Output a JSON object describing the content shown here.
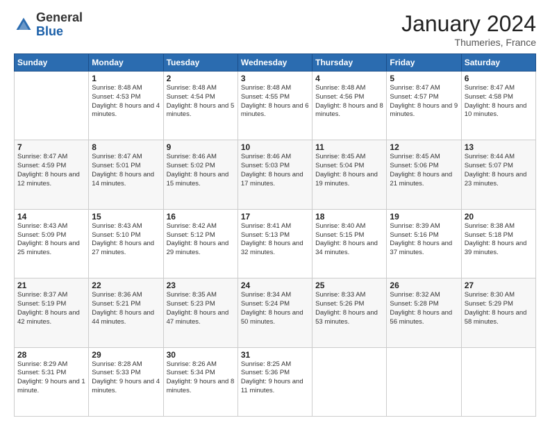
{
  "logo": {
    "general": "General",
    "blue": "Blue"
  },
  "header": {
    "title": "January 2024",
    "location": "Thumeries, France"
  },
  "weekdays": [
    "Sunday",
    "Monday",
    "Tuesday",
    "Wednesday",
    "Thursday",
    "Friday",
    "Saturday"
  ],
  "weeks": [
    [
      {
        "day": "",
        "sunrise": "",
        "sunset": "",
        "daylight": ""
      },
      {
        "day": "1",
        "sunrise": "8:48 AM",
        "sunset": "4:53 PM",
        "daylight": "8 hours and 4 minutes."
      },
      {
        "day": "2",
        "sunrise": "8:48 AM",
        "sunset": "4:54 PM",
        "daylight": "8 hours and 5 minutes."
      },
      {
        "day": "3",
        "sunrise": "8:48 AM",
        "sunset": "4:55 PM",
        "daylight": "8 hours and 6 minutes."
      },
      {
        "day": "4",
        "sunrise": "8:48 AM",
        "sunset": "4:56 PM",
        "daylight": "8 hours and 8 minutes."
      },
      {
        "day": "5",
        "sunrise": "8:47 AM",
        "sunset": "4:57 PM",
        "daylight": "8 hours and 9 minutes."
      },
      {
        "day": "6",
        "sunrise": "8:47 AM",
        "sunset": "4:58 PM",
        "daylight": "8 hours and 10 minutes."
      }
    ],
    [
      {
        "day": "7",
        "sunrise": "8:47 AM",
        "sunset": "4:59 PM",
        "daylight": "8 hours and 12 minutes."
      },
      {
        "day": "8",
        "sunrise": "8:47 AM",
        "sunset": "5:01 PM",
        "daylight": "8 hours and 14 minutes."
      },
      {
        "day": "9",
        "sunrise": "8:46 AM",
        "sunset": "5:02 PM",
        "daylight": "8 hours and 15 minutes."
      },
      {
        "day": "10",
        "sunrise": "8:46 AM",
        "sunset": "5:03 PM",
        "daylight": "8 hours and 17 minutes."
      },
      {
        "day": "11",
        "sunrise": "8:45 AM",
        "sunset": "5:04 PM",
        "daylight": "8 hours and 19 minutes."
      },
      {
        "day": "12",
        "sunrise": "8:45 AM",
        "sunset": "5:06 PM",
        "daylight": "8 hours and 21 minutes."
      },
      {
        "day": "13",
        "sunrise": "8:44 AM",
        "sunset": "5:07 PM",
        "daylight": "8 hours and 23 minutes."
      }
    ],
    [
      {
        "day": "14",
        "sunrise": "8:43 AM",
        "sunset": "5:09 PM",
        "daylight": "8 hours and 25 minutes."
      },
      {
        "day": "15",
        "sunrise": "8:43 AM",
        "sunset": "5:10 PM",
        "daylight": "8 hours and 27 minutes."
      },
      {
        "day": "16",
        "sunrise": "8:42 AM",
        "sunset": "5:12 PM",
        "daylight": "8 hours and 29 minutes."
      },
      {
        "day": "17",
        "sunrise": "8:41 AM",
        "sunset": "5:13 PM",
        "daylight": "8 hours and 32 minutes."
      },
      {
        "day": "18",
        "sunrise": "8:40 AM",
        "sunset": "5:15 PM",
        "daylight": "8 hours and 34 minutes."
      },
      {
        "day": "19",
        "sunrise": "8:39 AM",
        "sunset": "5:16 PM",
        "daylight": "8 hours and 37 minutes."
      },
      {
        "day": "20",
        "sunrise": "8:38 AM",
        "sunset": "5:18 PM",
        "daylight": "8 hours and 39 minutes."
      }
    ],
    [
      {
        "day": "21",
        "sunrise": "8:37 AM",
        "sunset": "5:19 PM",
        "daylight": "8 hours and 42 minutes."
      },
      {
        "day": "22",
        "sunrise": "8:36 AM",
        "sunset": "5:21 PM",
        "daylight": "8 hours and 44 minutes."
      },
      {
        "day": "23",
        "sunrise": "8:35 AM",
        "sunset": "5:23 PM",
        "daylight": "8 hours and 47 minutes."
      },
      {
        "day": "24",
        "sunrise": "8:34 AM",
        "sunset": "5:24 PM",
        "daylight": "8 hours and 50 minutes."
      },
      {
        "day": "25",
        "sunrise": "8:33 AM",
        "sunset": "5:26 PM",
        "daylight": "8 hours and 53 minutes."
      },
      {
        "day": "26",
        "sunrise": "8:32 AM",
        "sunset": "5:28 PM",
        "daylight": "8 hours and 56 minutes."
      },
      {
        "day": "27",
        "sunrise": "8:30 AM",
        "sunset": "5:29 PM",
        "daylight": "8 hours and 58 minutes."
      }
    ],
    [
      {
        "day": "28",
        "sunrise": "8:29 AM",
        "sunset": "5:31 PM",
        "daylight": "9 hours and 1 minute."
      },
      {
        "day": "29",
        "sunrise": "8:28 AM",
        "sunset": "5:33 PM",
        "daylight": "9 hours and 4 minutes."
      },
      {
        "day": "30",
        "sunrise": "8:26 AM",
        "sunset": "5:34 PM",
        "daylight": "9 hours and 8 minutes."
      },
      {
        "day": "31",
        "sunrise": "8:25 AM",
        "sunset": "5:36 PM",
        "daylight": "9 hours and 11 minutes."
      },
      {
        "day": "",
        "sunrise": "",
        "sunset": "",
        "daylight": ""
      },
      {
        "day": "",
        "sunrise": "",
        "sunset": "",
        "daylight": ""
      },
      {
        "day": "",
        "sunrise": "",
        "sunset": "",
        "daylight": ""
      }
    ]
  ]
}
